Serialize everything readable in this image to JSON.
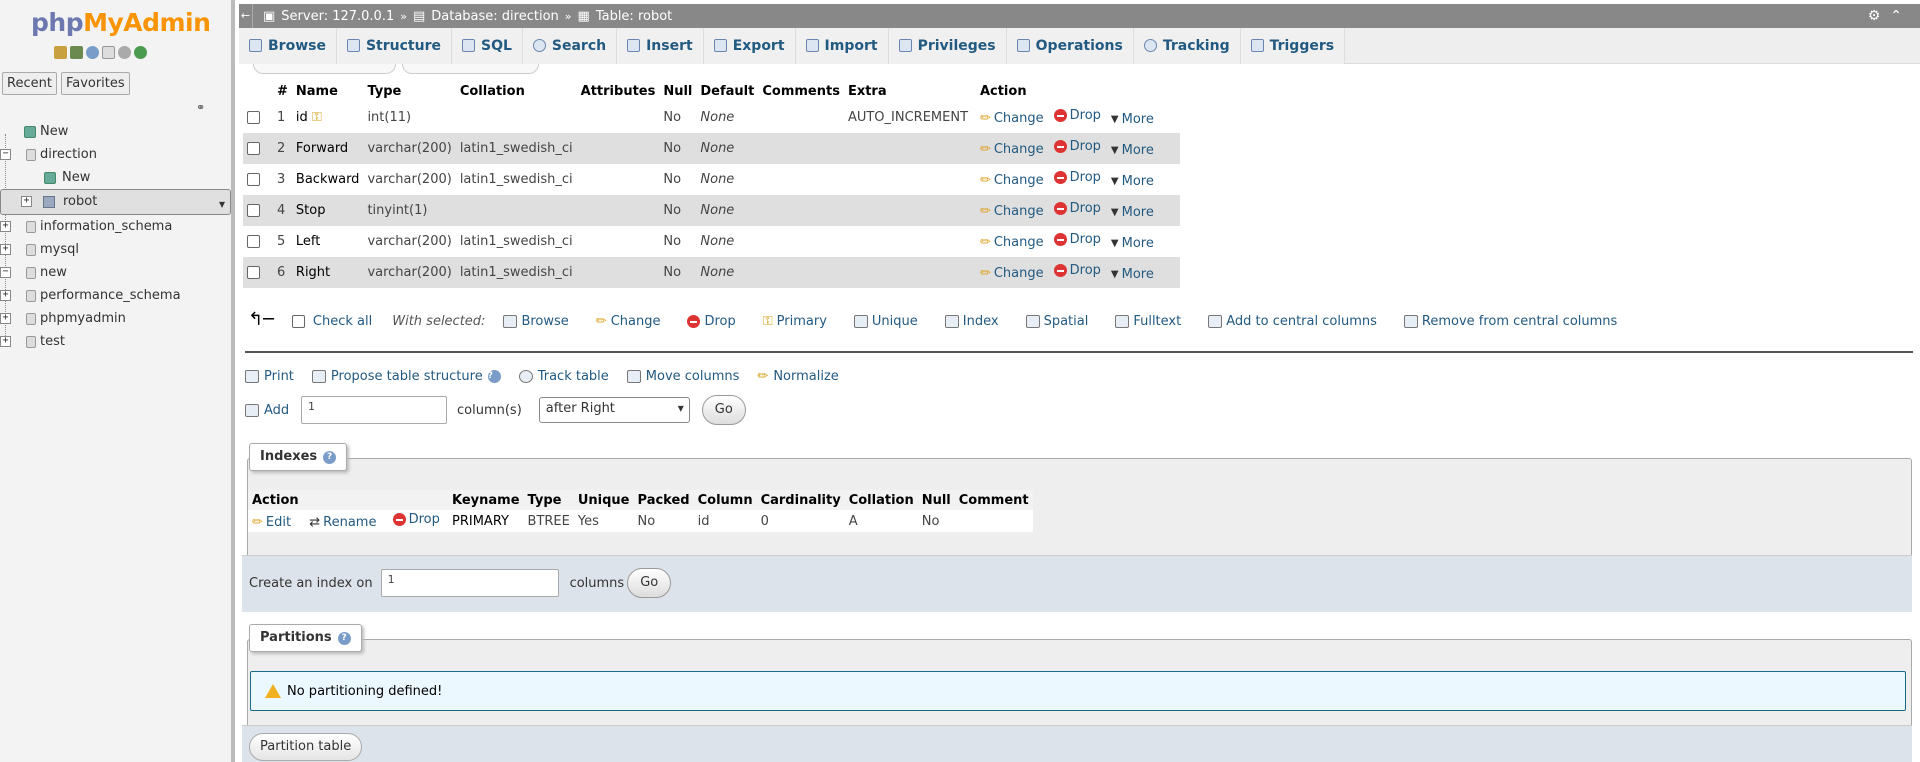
{
  "sidebar": {
    "logo_php": "php",
    "logo_myadmin": "MyAdmin",
    "tabs": [
      "Recent",
      "Favorites"
    ],
    "tree": [
      {
        "label": "New"
      },
      {
        "label": "direction"
      },
      {
        "label": "New"
      },
      {
        "label": "robot"
      },
      {
        "label": "information_schema"
      },
      {
        "label": "mysql"
      },
      {
        "label": "new"
      },
      {
        "label": "performance_schema"
      },
      {
        "label": "phpmyadmin"
      },
      {
        "label": "test"
      }
    ]
  },
  "breadcrumb": {
    "server": "Server: 127.0.0.1",
    "database": "Database: direction",
    "table": "Table: robot"
  },
  "tabs": [
    "Browse",
    "Structure",
    "SQL",
    "Search",
    "Insert",
    "Export",
    "Import",
    "Privileges",
    "Operations",
    "Tracking",
    "Triggers"
  ],
  "structure": {
    "headers": [
      "#",
      "Name",
      "Type",
      "Collation",
      "Attributes",
      "Null",
      "Default",
      "Comments",
      "Extra",
      "Action"
    ],
    "rows": [
      {
        "num": "1",
        "name": "id",
        "type": "int(11)",
        "collation": "",
        "null": "No",
        "default": "None",
        "extra": "AUTO_INCREMENT"
      },
      {
        "num": "2",
        "name": "Forward",
        "type": "varchar(200)",
        "collation": "latin1_swedish_ci",
        "null": "No",
        "default": "None",
        "extra": ""
      },
      {
        "num": "3",
        "name": "Backward",
        "type": "varchar(200)",
        "collation": "latin1_swedish_ci",
        "null": "No",
        "default": "None",
        "extra": ""
      },
      {
        "num": "4",
        "name": "Stop",
        "type": "tinyint(1)",
        "collation": "",
        "null": "No",
        "default": "None",
        "extra": ""
      },
      {
        "num": "5",
        "name": "Left",
        "type": "varchar(200)",
        "collation": "latin1_swedish_ci",
        "null": "No",
        "default": "None",
        "extra": ""
      },
      {
        "num": "6",
        "name": "Right",
        "type": "varchar(200)",
        "collation": "latin1_swedish_ci",
        "null": "No",
        "default": "None",
        "extra": ""
      }
    ],
    "action_change": "Change",
    "action_drop": "Drop",
    "action_more": "More"
  },
  "with_selected": {
    "check_all": "Check all",
    "label": "With selected:",
    "actions": [
      "Browse",
      "Change",
      "Drop",
      "Primary",
      "Unique",
      "Index",
      "Spatial",
      "Fulltext",
      "Add to central columns",
      "Remove from central columns"
    ]
  },
  "tools": [
    "Print",
    "Propose table structure",
    "Track table",
    "Move columns",
    "Normalize"
  ],
  "add_column": {
    "label": "Add",
    "count_value": "1",
    "suffix": "column(s)",
    "position_selected": "after Right",
    "go": "Go"
  },
  "indexes": {
    "legend": "Indexes",
    "headers": [
      "Action",
      "Keyname",
      "Type",
      "Unique",
      "Packed",
      "Column",
      "Cardinality",
      "Collation",
      "Null",
      "Comment"
    ],
    "row": {
      "edit": "Edit",
      "rename": "Rename",
      "drop": "Drop",
      "keyname": "PRIMARY",
      "type": "BTREE",
      "unique": "Yes",
      "packed": "No",
      "column": "id",
      "cardinality": "0",
      "collation": "A",
      "null": "No",
      "comment": ""
    },
    "create_label": "Create an index on",
    "create_value": "1",
    "create_suffix": "columns",
    "go": "Go"
  },
  "partitions": {
    "legend": "Partitions",
    "notice": "No partitioning defined!",
    "button": "Partition table"
  }
}
